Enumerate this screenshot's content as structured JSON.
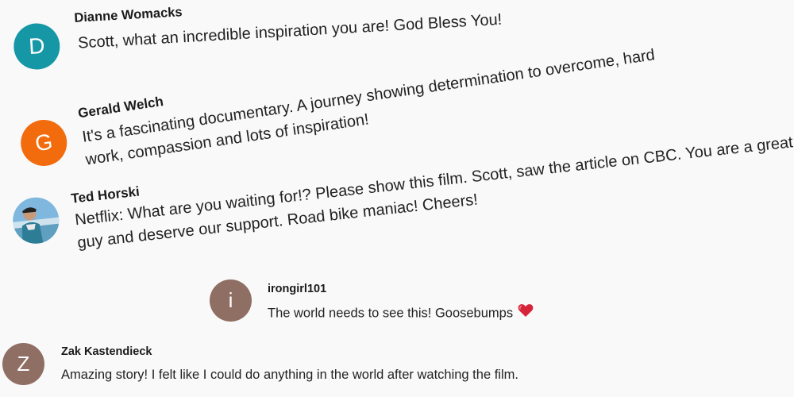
{
  "comments": [
    {
      "author": "Dianne Womacks",
      "avatar_letter": "D",
      "avatar_color": "#1597a6",
      "text": "Scott, what an incredible inspiration you are! God Bless You!"
    },
    {
      "author": "Gerald Welch",
      "avatar_letter": "G",
      "avatar_color": "#f26b0d",
      "text": "It's a fascinating documentary.  A journey showing determination to overcome, hard work, compassion and lots of inspiration!"
    },
    {
      "author": "Ted Horski",
      "avatar_icon": "profile-photo-icon",
      "text": "Netflix: What are you waiting for!? Please show this film. Scott, saw the article on CBC. You are a great guy and deserve our support. Road bike maniac! Cheers!"
    },
    {
      "author": "irongirl101",
      "avatar_letter": "i",
      "avatar_color": "#8f6e63",
      "text": "The world needs to see this!  Goosebumps",
      "emoji": "heart-icon"
    },
    {
      "author": "Zak Kastendieck",
      "avatar_letter": "Z",
      "avatar_color": "#8f6e63",
      "text": "Amazing story! I felt like I could do anything in the world after watching the film."
    }
  ]
}
